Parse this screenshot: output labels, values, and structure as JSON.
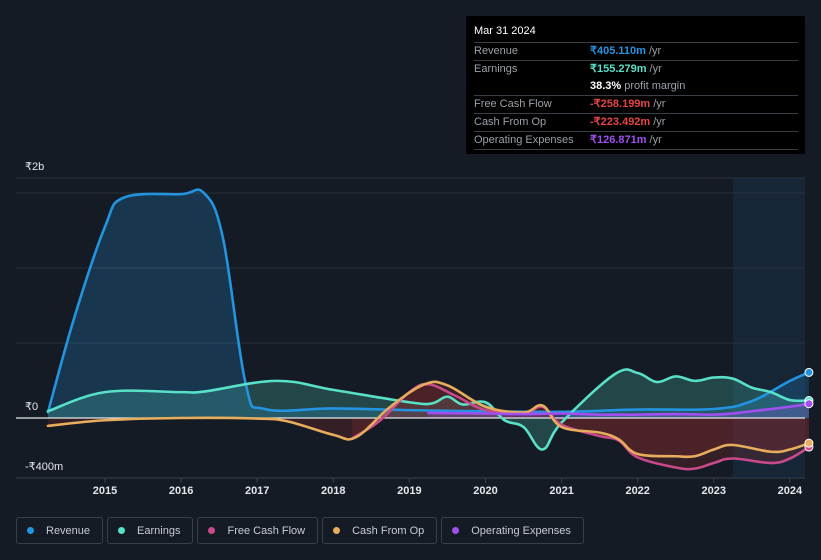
{
  "tooltip": {
    "date": "Mar 31 2024",
    "rows": [
      {
        "label": "Revenue",
        "value": "₹405.110m",
        "unit": "/yr",
        "color": "#2394df"
      },
      {
        "label": "Earnings",
        "value": "₹155.279m",
        "unit": "/yr",
        "color": "#58e0c8"
      },
      {
        "label": "",
        "value": "38.3%",
        "unit": "profit margin",
        "color": "#ffffff"
      },
      {
        "label": "Free Cash Flow",
        "value": "-₹258.199m",
        "unit": "/yr",
        "color": "#e64545"
      },
      {
        "label": "Cash From Op",
        "value": "-₹223.492m",
        "unit": "/yr",
        "color": "#e64545"
      },
      {
        "label": "Operating Expenses",
        "value": "₹126.871m",
        "unit": "/yr",
        "color": "#a14ff0"
      }
    ]
  },
  "legend": [
    {
      "label": "Revenue",
      "color": "#2394df"
    },
    {
      "label": "Earnings",
      "color": "#58e0c8"
    },
    {
      "label": "Free Cash Flow",
      "color": "#c94a8c"
    },
    {
      "label": "Cash From Op",
      "color": "#e8ad5c"
    },
    {
      "label": "Operating Expenses",
      "color": "#a14ff0"
    }
  ],
  "chart_data": {
    "type": "area",
    "title": "",
    "xlabel": "",
    "ylabel": "",
    "unit": "₹ millions",
    "y_tick_labels": [
      "₹2b",
      "₹0",
      "-₹400m"
    ],
    "y_ticks": [
      2000,
      0,
      -400
    ],
    "ylim": [
      -533,
      2133
    ],
    "x_tick_labels": [
      "2015",
      "2016",
      "2017",
      "2018",
      "2019",
      "2020",
      "2021",
      "2022",
      "2023",
      "2024"
    ],
    "xlim": [
      2014.25,
      2024.25
    ],
    "grid": true,
    "legend_position": "bottom",
    "highlight_from": 2023.25,
    "series": [
      {
        "name": "Revenue",
        "color": "#2394df",
        "x": [
          2014.25,
          2014.6,
          2015.0,
          2015.25,
          2016.0,
          2016.3,
          2016.55,
          2016.85,
          2017.1,
          2018.0,
          2019.0,
          2020.0,
          2021.0,
          2022.0,
          2023.0,
          2023.5,
          2024.0,
          2024.25
        ],
        "y": [
          50,
          900,
          1700,
          1960,
          1990,
          2000,
          1600,
          300,
          80,
          85,
          70,
          60,
          55,
          75,
          80,
          150,
          330,
          405.11
        ]
      },
      {
        "name": "Earnings",
        "color": "#58e0c8",
        "x": [
          2014.25,
          2015.0,
          2016.0,
          2016.3,
          2017.25,
          2018.0,
          2019.0,
          2019.3,
          2019.5,
          2019.7,
          2020.0,
          2020.25,
          2020.5,
          2020.75,
          2021.0,
          2021.7,
          2022.0,
          2022.25,
          2022.5,
          2022.75,
          2023.0,
          2023.25,
          2023.5,
          2023.75,
          2024.0,
          2024.25
        ],
        "y": [
          60,
          230,
          230,
          235,
          330,
          250,
          140,
          130,
          190,
          120,
          140,
          -20,
          -80,
          -280,
          -40,
          390,
          400,
          320,
          370,
          330,
          360,
          350,
          270,
          230,
          160,
          155.28
        ]
      },
      {
        "name": "Free Cash Flow",
        "color": "#c94a8c",
        "x": [
          2018.25,
          2018.6,
          2019.0,
          2019.25,
          2019.6,
          2020.0,
          2020.5,
          2020.75,
          2021.0,
          2021.5,
          2021.75,
          2022.0,
          2022.5,
          2022.75,
          2023.0,
          2023.25,
          2023.75,
          2024.0,
          2024.25
        ],
        "y": [
          -180,
          -30,
          230,
          300,
          200,
          70,
          40,
          100,
          -60,
          -160,
          -200,
          -350,
          -440,
          -450,
          -400,
          -360,
          -400,
          -360,
          -258.2
        ]
      },
      {
        "name": "Cash From Op",
        "color": "#e8ad5c",
        "x": [
          2014.25,
          2015.0,
          2016.0,
          2017.0,
          2017.4,
          2018.0,
          2018.3,
          2018.75,
          2019.2,
          2019.5,
          2020.0,
          2020.5,
          2020.75,
          2021.0,
          2021.5,
          2021.75,
          2022.0,
          2022.5,
          2022.75,
          2023.0,
          2023.25,
          2023.75,
          2024.0,
          2024.25
        ],
        "y": [
          -70,
          -20,
          0,
          -5,
          -30,
          -150,
          -170,
          100,
          300,
          290,
          100,
          50,
          110,
          -80,
          -130,
          -190,
          -320,
          -340,
          -340,
          -280,
          -240,
          -300,
          -280,
          -223.49
        ]
      },
      {
        "name": "Operating Expenses",
        "color": "#a14ff0",
        "x": [
          2019.25,
          2020.0,
          2020.5,
          2021.0,
          2021.5,
          2022.0,
          2022.5,
          2023.0,
          2023.25,
          2023.5,
          2024.0,
          2024.25
        ],
        "y": [
          45,
          40,
          35,
          40,
          30,
          30,
          35,
          30,
          40,
          60,
          100,
          126.87
        ]
      }
    ]
  }
}
